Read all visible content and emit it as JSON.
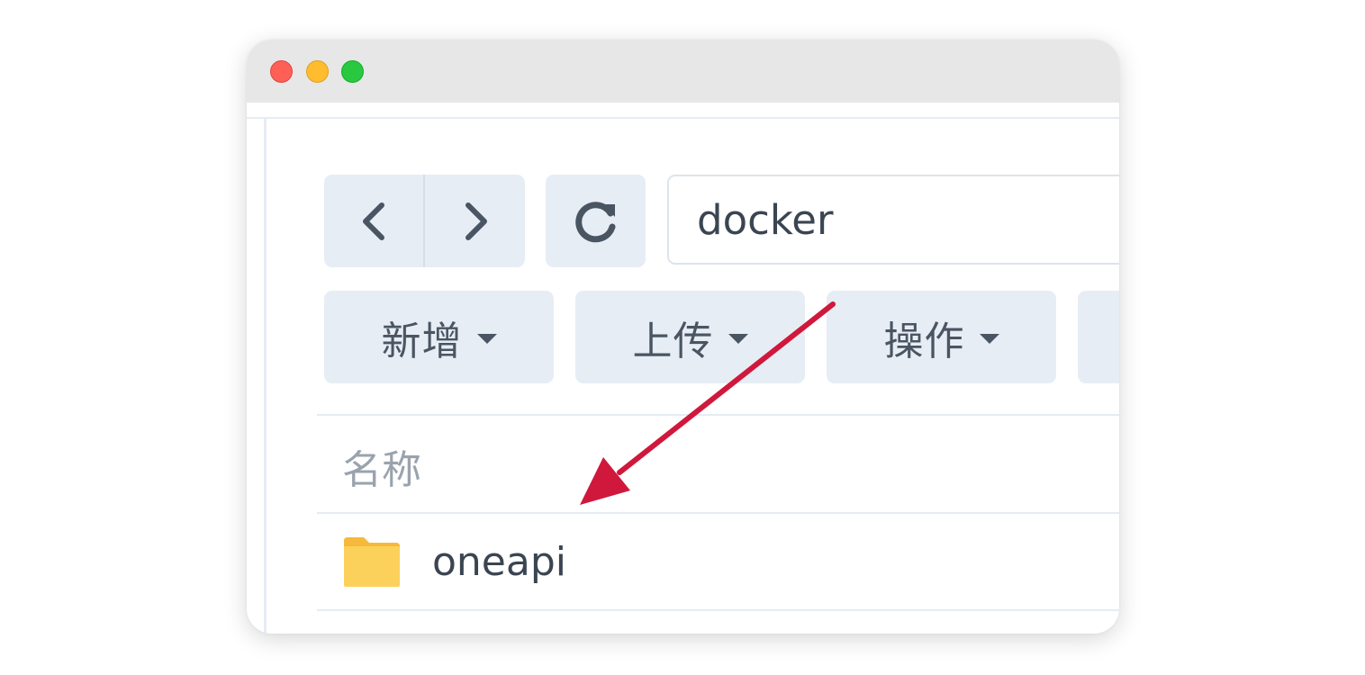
{
  "window": {
    "controls": [
      "close",
      "minimize",
      "zoom"
    ]
  },
  "toolbar": {
    "back_icon": "chevron-left-icon",
    "forward_icon": "chevron-right-icon",
    "refresh_icon": "refresh-icon",
    "path_value": "docker"
  },
  "actions": [
    {
      "label": "新增"
    },
    {
      "label": "上传"
    },
    {
      "label": "操作"
    }
  ],
  "file_list": {
    "column_name": "名称",
    "items": [
      {
        "name": "oneapi",
        "icon": "folder-icon"
      }
    ]
  },
  "annotation": {
    "arrow_color": "#d0183c",
    "points_to": "oneapi"
  },
  "colors": {
    "button_bg": "#e7edf4",
    "folder": "#fcd15b",
    "titlebar": "#e7e7e7"
  }
}
